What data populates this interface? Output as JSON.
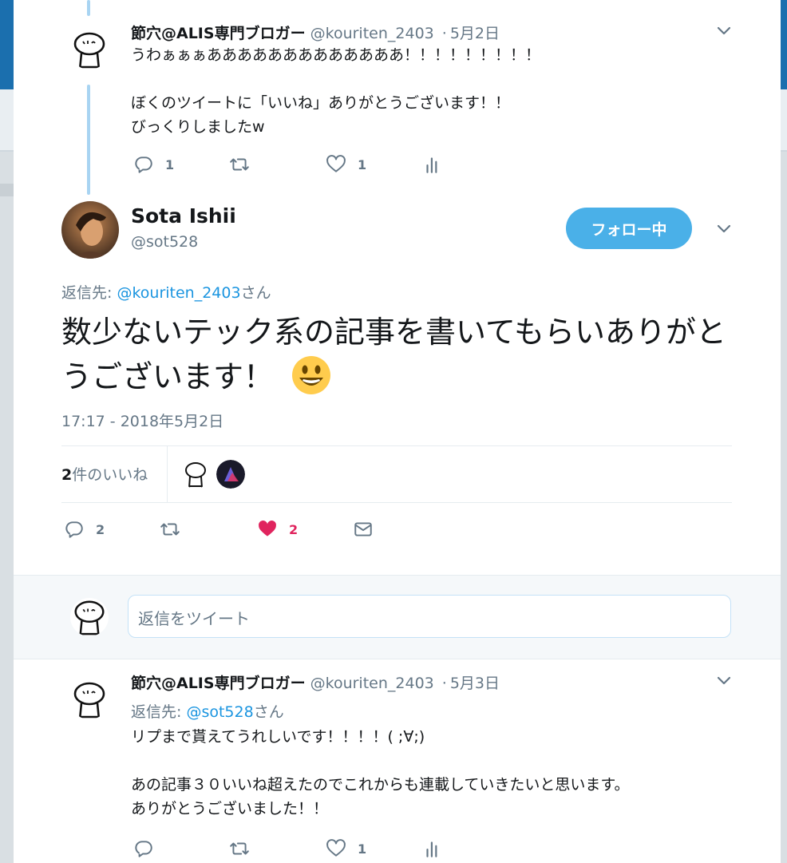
{
  "tweet1": {
    "name": "節穴@ALIS専門ブロガー",
    "handle": "@kouriten_2403",
    "date": "5月2日",
    "text": "うわぁぁぁあああああああああああああ！！！！！！！！！\n\nぼくのツイートに「いいね」ありがとうございます！！\nびっくりしましたw",
    "reply_count": "1",
    "like_count": "1"
  },
  "main_tweet": {
    "name": "Sota Ishii",
    "handle": "@sot528",
    "follow_label": "フォロー中",
    "reply_to_prefix": "返信先: ",
    "reply_to_handle": "@kouriten_2403",
    "reply_to_suffix": "さん",
    "text": "数少ないテック系の記事を書いてもらいありがとうございます！",
    "emoji": "smiley-emoji",
    "timestamp": "17:17 - 2018年5月2日",
    "likes_count": "2",
    "likes_label": "件のいいね",
    "reply_count": "2",
    "like_count": "2",
    "like_color": "#e0245e"
  },
  "reply_box": {
    "placeholder": "返信をツイート"
  },
  "tweet3": {
    "name": "節穴@ALIS専門ブロガー",
    "handle": "@kouriten_2403",
    "date": "5月3日",
    "reply_to_prefix": "返信先: ",
    "reply_to_handle": "@sot528",
    "reply_to_suffix": "さん",
    "text": "リプまで貰えてうれしいです！！！！( ;∀;)\n\nあの記事３０いいね超えたのでこれからも連載していきたいと思います。\nありがとうございました！！",
    "like_count": "1"
  },
  "colors": {
    "accent": "#1b95e0",
    "follow_button": "#4ab0e8",
    "thread_line": "#a8d4f2",
    "like_active": "#e0245e"
  }
}
